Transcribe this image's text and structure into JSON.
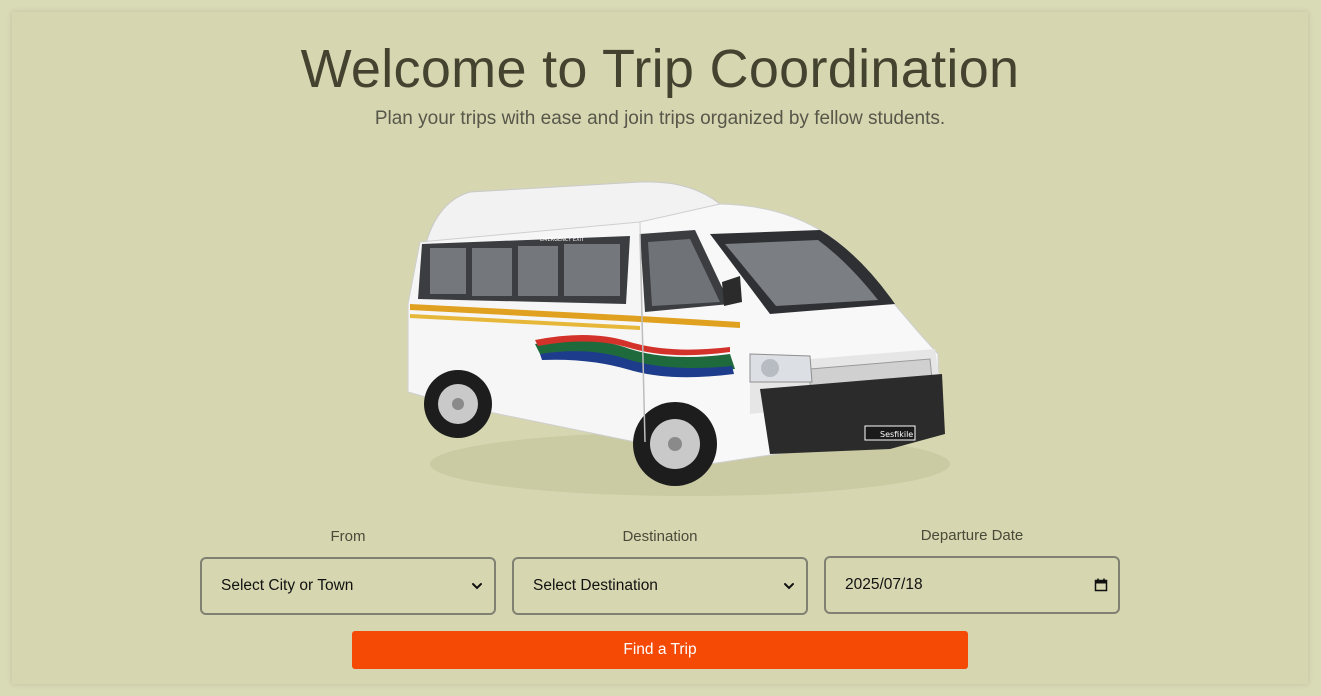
{
  "header": {
    "title": "Welcome to Trip Coordination",
    "subtitle": "Plan your trips with ease and join trips organized by fellow students."
  },
  "hero_image": {
    "subject": "white minibus taxi",
    "text": {
      "emergency_exit": "EMERGENCY EXIT",
      "badge": "Sesfikile"
    }
  },
  "form": {
    "from": {
      "label": "From",
      "value": "Select City or Town"
    },
    "destination": {
      "label": "Destination",
      "value": "Select Destination"
    },
    "departure_date": {
      "label": "Departure Date",
      "value": "2025/07/18"
    },
    "submit_label": "Find a Trip"
  },
  "icons": {
    "select_arrow": "chevron-down-icon",
    "date_picker": "calendar-icon"
  },
  "colors": {
    "page_background": "#d6d7b0",
    "primary_button": "#f44a05",
    "title_text": "#434330"
  }
}
